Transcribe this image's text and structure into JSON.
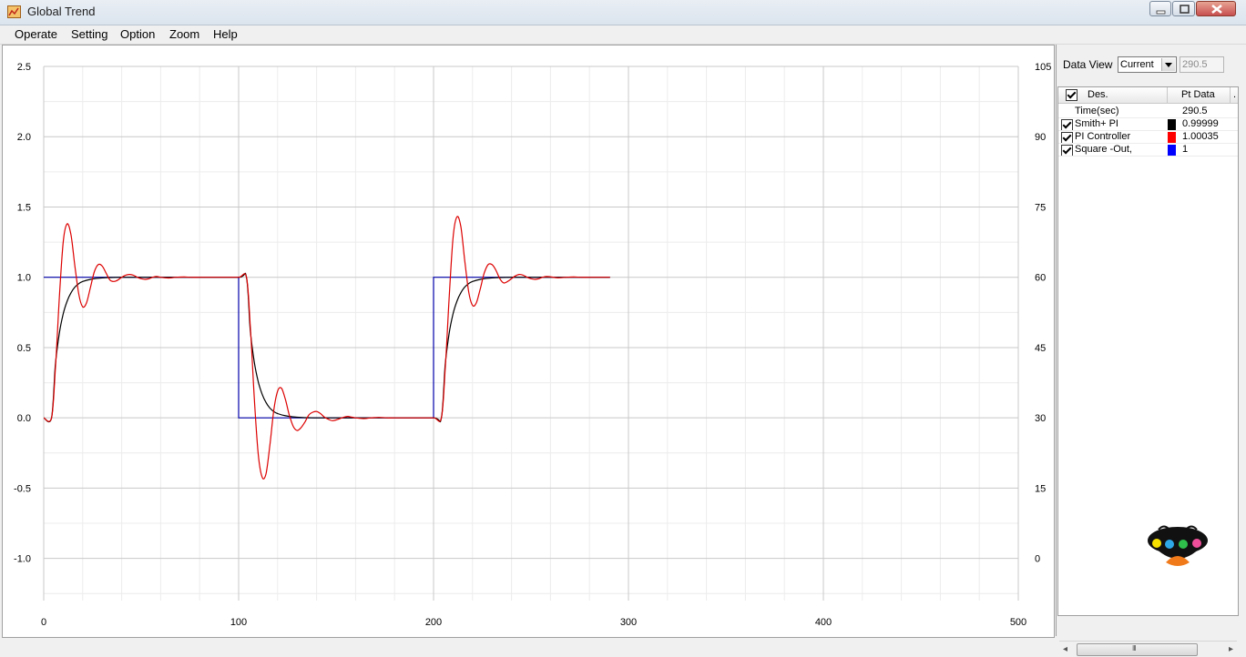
{
  "window": {
    "title": "Global Trend",
    "icon": "chart-icon",
    "buttons": [
      "minimize-icon",
      "maximize-icon",
      "close-icon"
    ]
  },
  "menu": {
    "items": [
      "Operate",
      "Setting",
      "Option",
      "Zoom",
      "Help"
    ]
  },
  "panel": {
    "data_view_label": "Data View",
    "data_view_selected": "Current",
    "data_view_value": "290.5",
    "columns": [
      "Des.",
      "Pt Data",
      "."
    ],
    "time_label": "Time(sec)",
    "time_value": "290.5",
    "rows": [
      {
        "name": "Smith+ PI",
        "value": "0.99999",
        "color": "#000000",
        "checked": true
      },
      {
        "name": "PI Controller",
        "value": "1.00035",
        "color": "#ff0000",
        "checked": true
      },
      {
        "name": "Square -Out,",
        "value": "1",
        "color": "#0000ff",
        "checked": true
      }
    ],
    "scroll_grip": "III"
  },
  "chart_data": {
    "type": "line",
    "title": "",
    "xlabel": "",
    "ylabel": "",
    "xlim": [
      0,
      500
    ],
    "ylim": [
      -1.3,
      2.5
    ],
    "y2lim": [
      -9,
      105
    ],
    "x_ticks": [
      "0",
      "100",
      "200",
      "300",
      "400",
      "500"
    ],
    "y_ticks": [
      "2.5",
      "2.0",
      "1.5",
      "1.0",
      "0.5",
      "0.0",
      "-0.5",
      "-1.0"
    ],
    "y2_ticks": [
      "105",
      "90",
      "75",
      "60",
      "45",
      "30",
      "15",
      "0"
    ],
    "grid": true,
    "legend": "side-panel",
    "series": [
      {
        "name": "Square -Out,",
        "color": "#0000aa",
        "x": [
          0,
          100,
          100,
          200,
          200,
          290.5
        ],
        "y": [
          1,
          1,
          0,
          0,
          1,
          1
        ]
      },
      {
        "name": "Smith+ PI",
        "color": "#000000",
        "x": [
          0,
          4,
          6,
          8,
          10,
          12,
          14,
          16,
          18,
          20,
          24,
          28,
          32,
          36,
          40,
          50,
          60,
          80,
          100,
          104,
          106,
          108,
          110,
          112,
          114,
          116,
          118,
          120,
          124,
          128,
          132,
          136,
          140,
          150,
          160,
          180,
          200,
          204,
          206,
          208,
          210,
          212,
          214,
          216,
          218,
          220,
          224,
          228,
          232,
          236,
          240,
          250,
          260,
          280,
          290.5
        ],
        "y": [
          0,
          0,
          0.38,
          0.6,
          0.74,
          0.83,
          0.89,
          0.93,
          0.955,
          0.97,
          0.985,
          0.993,
          0.997,
          0.999,
          1,
          1,
          1,
          1,
          1,
          1,
          0.62,
          0.4,
          0.26,
          0.17,
          0.11,
          0.07,
          0.045,
          0.03,
          0.015,
          0.007,
          0.003,
          0.001,
          0,
          0,
          0,
          0,
          0,
          0,
          0.38,
          0.6,
          0.74,
          0.83,
          0.89,
          0.93,
          0.955,
          0.97,
          0.985,
          0.993,
          0.997,
          0.999,
          1,
          1,
          1,
          1,
          0.99999
        ]
      },
      {
        "name": "PI Controller",
        "color": "#dd0000",
        "x": [
          0,
          4,
          6,
          8,
          10,
          12,
          14,
          16,
          18,
          20,
          22,
          24,
          26,
          28,
          30,
          32,
          34,
          36,
          38,
          40,
          42,
          44,
          46,
          48,
          50,
          52,
          54,
          56,
          58,
          60,
          64,
          68,
          72,
          76,
          80,
          90,
          100,
          104,
          106,
          108,
          110,
          112,
          114,
          116,
          118,
          120,
          122,
          124,
          126,
          128,
          130,
          132,
          134,
          136,
          138,
          140,
          142,
          144,
          146,
          148,
          150,
          152,
          154,
          156,
          158,
          160,
          164,
          168,
          172,
          176,
          180,
          190,
          200,
          204,
          206,
          208,
          210,
          212,
          214,
          216,
          218,
          220,
          222,
          224,
          226,
          228,
          230,
          232,
          234,
          236,
          238,
          240,
          242,
          244,
          246,
          248,
          250,
          252,
          254,
          256,
          258,
          260,
          264,
          268,
          272,
          276,
          280,
          290.5
        ],
        "y": [
          0,
          0,
          0.35,
          0.85,
          1.25,
          1.38,
          1.3,
          1.08,
          0.88,
          0.79,
          0.82,
          0.93,
          1.04,
          1.09,
          1.08,
          1.03,
          0.98,
          0.97,
          0.98,
          1.0,
          1.015,
          1.02,
          1.015,
          1.0,
          0.99,
          0.985,
          0.99,
          1.0,
          1.005,
          1.0,
          0.995,
          1.0,
          1.002,
          1.0,
          1.0,
          1.0,
          1.0,
          1.0,
          0.65,
          0.15,
          -0.25,
          -0.42,
          -0.4,
          -0.2,
          0.05,
          0.19,
          0.21,
          0.13,
          0.02,
          -0.06,
          -0.09,
          -0.07,
          -0.03,
          0.02,
          0.04,
          0.045,
          0.03,
          0.005,
          -0.01,
          -0.02,
          -0.015,
          -0.005,
          0.005,
          0.01,
          0.005,
          0.0,
          -0.005,
          0.0,
          0.003,
          0.0,
          0.0,
          0.0,
          0.0,
          0.0,
          0.35,
          0.85,
          1.28,
          1.43,
          1.36,
          1.12,
          0.9,
          0.8,
          0.82,
          0.92,
          1.03,
          1.09,
          1.09,
          1.05,
          0.99,
          0.96,
          0.97,
          0.99,
          1.01,
          1.02,
          1.015,
          1.0,
          0.99,
          0.985,
          0.99,
          1.0,
          1.005,
          1.003,
          0.996,
          1.0,
          1.002,
          1.0,
          1.0,
          1.00035
        ]
      }
    ]
  }
}
